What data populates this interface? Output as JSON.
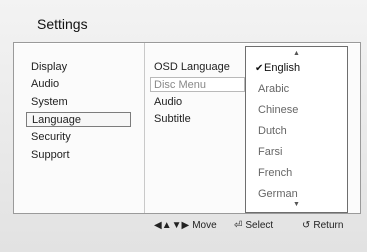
{
  "title": "Settings",
  "left_menu": [
    {
      "label": "Display"
    },
    {
      "label": "Audio"
    },
    {
      "label": "System"
    },
    {
      "label": "Language"
    },
    {
      "label": "Security"
    },
    {
      "label": "Support"
    }
  ],
  "middle_menu": [
    {
      "label": "OSD Language"
    },
    {
      "label": "Disc Menu"
    },
    {
      "label": "Audio"
    },
    {
      "label": "Subtitle"
    }
  ],
  "dropdown": {
    "selected": "English",
    "options": [
      {
        "label": "English"
      },
      {
        "label": "Arabic"
      },
      {
        "label": "Chinese"
      },
      {
        "label": "Dutch"
      },
      {
        "label": "Farsi"
      },
      {
        "label": "French"
      },
      {
        "label": "German"
      }
    ],
    "check_mark": "✔",
    "scroll_up_icon": "up-arrow-icon",
    "scroll_down_icon": "down-arrow-icon"
  },
  "footer": {
    "move_label": "Move",
    "select_label": "Select",
    "return_label": "Return"
  }
}
